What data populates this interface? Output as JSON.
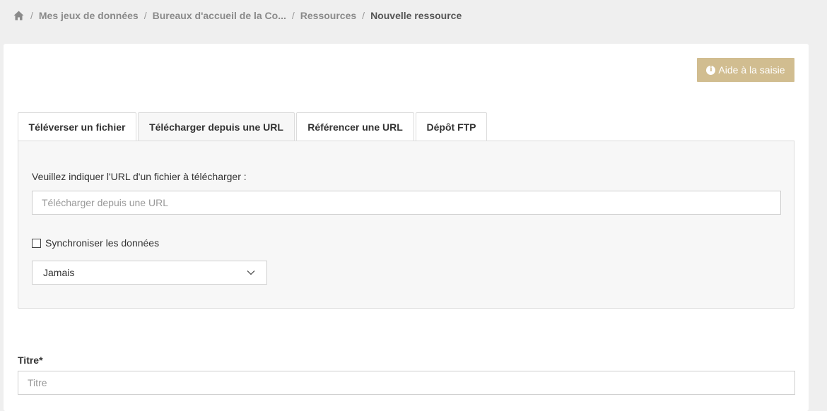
{
  "breadcrumb": {
    "home_icon": "home-icon",
    "separator": "/",
    "items": [
      "Mes jeux de données",
      "Bureaux d'accueil de la Co...",
      "Ressources"
    ],
    "current": "Nouvelle ressource"
  },
  "help_button": {
    "icon": "info-icon",
    "icon_glyph": "i",
    "label": "Aide à la saisie"
  },
  "tabs": [
    {
      "label": "Téléverser un fichier"
    },
    {
      "label": "Télécharger depuis une URL"
    },
    {
      "label": "Référencer une URL"
    },
    {
      "label": "Dépôt FTP"
    }
  ],
  "active_tab": 1,
  "url_form": {
    "label": "Veuillez indiquer l'URL d'un fichier à télécharger :",
    "placeholder": "Télécharger depuis une URL",
    "value": ""
  },
  "sync": {
    "label": "Synchroniser les données",
    "checked": false
  },
  "frequency_select": {
    "selected": "Jamais"
  },
  "title_field": {
    "label": "Titre*",
    "placeholder": "Titre",
    "value": ""
  },
  "colors": {
    "accent": "#d1bd90",
    "panel_bg": "#f7f7f7",
    "page_bg": "#efefef"
  }
}
